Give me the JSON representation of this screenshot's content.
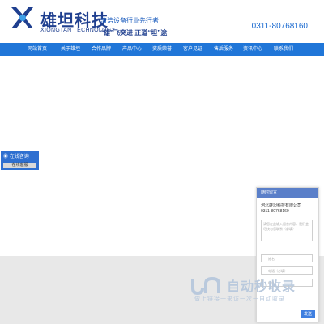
{
  "header": {
    "brand_cn": "雄坦科技",
    "brand_en": "XIONGTAN TECHNOLOGY",
    "slogan_line1": "清洁设备行业先行者",
    "slogan_line2": "“雄”飞突进 正道“坦”途",
    "phone": "0311-80768160"
  },
  "nav": {
    "items": [
      {
        "label": "网站首页"
      },
      {
        "label": "关于雄坦"
      },
      {
        "label": "合作品牌"
      },
      {
        "label": "产品中心"
      },
      {
        "label": "资质荣誉"
      },
      {
        "label": "客户见证"
      },
      {
        "label": "售后服务"
      },
      {
        "label": "资讯中心"
      },
      {
        "label": "联系我们"
      }
    ]
  },
  "online": {
    "title": "在线咨询",
    "button": "在线客服"
  },
  "chat": {
    "header": "随时留言",
    "company": "河北雄坦科技有限公司",
    "phone": "0311-80768160",
    "message_placeholder": "请您在此输入留言内容，我们会尽快与您联系（必填）",
    "name_placeholder": "姓名",
    "phone_placeholder": "电话（必填）",
    "address_placeholder": "地址",
    "send_label": "发送"
  },
  "watermark": {
    "title": "自动秒收录",
    "subtitle": "做上链接一来访一次一自动收录"
  },
  "colors": {
    "brand_blue": "#1f3f8f",
    "nav_blue": "#2076d8",
    "chat_header": "#5a7fc9"
  }
}
